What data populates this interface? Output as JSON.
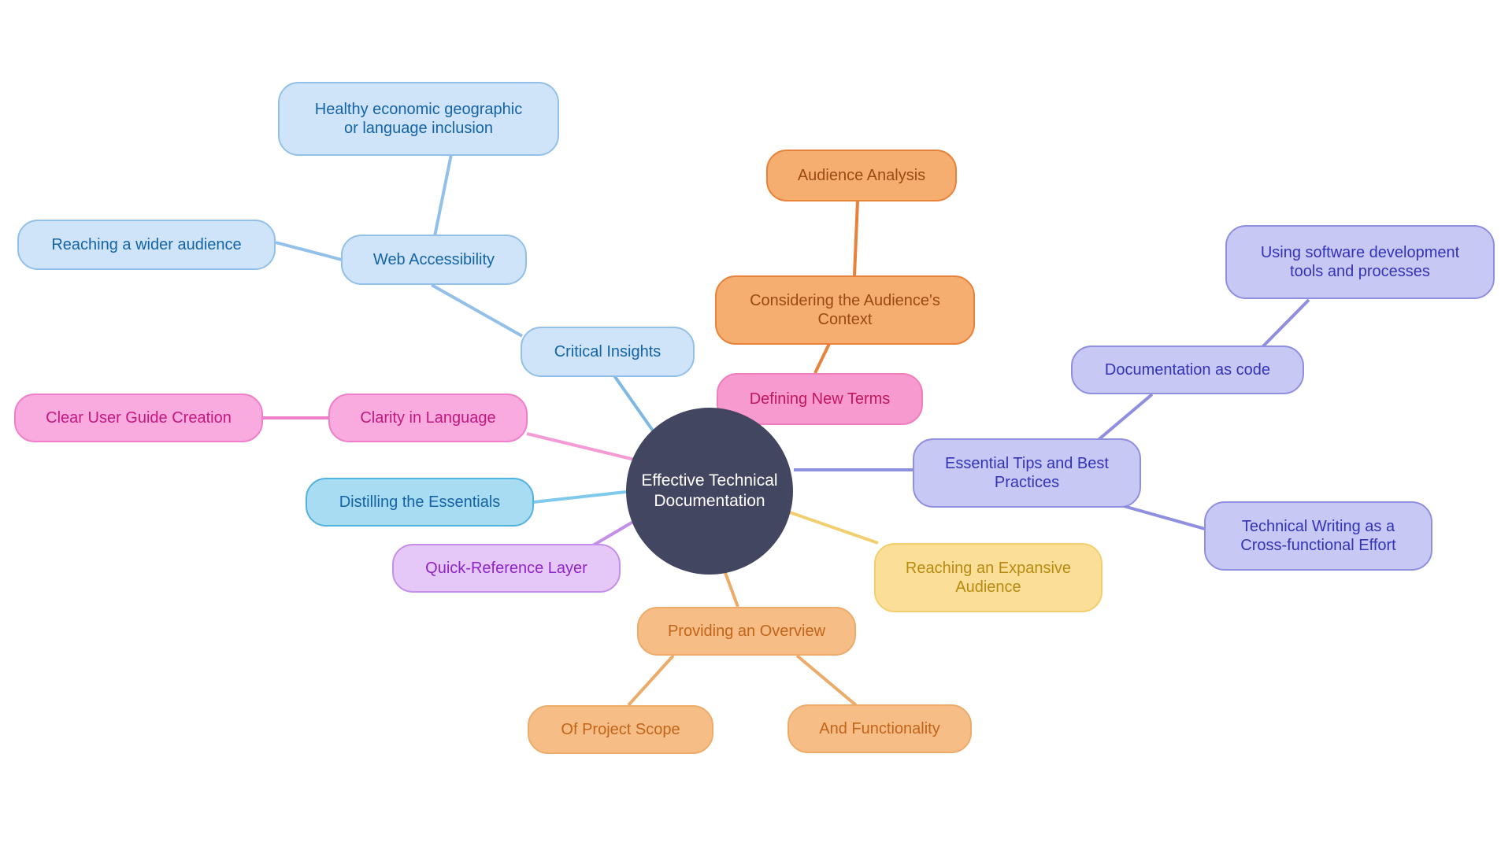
{
  "diagram": {
    "title": "Effective Technical Documentation",
    "type": "mindmap",
    "background": "#ffffff"
  },
  "nodes": {
    "root": {
      "label": "Effective Technical\nDocumentation"
    },
    "audience_analysis": {
      "label": "Audience Analysis"
    },
    "considering_context": {
      "label": "Considering the Audience's\nContext"
    },
    "defining_new_terms": {
      "label": "Defining New Terms"
    },
    "healthy_inclusion": {
      "label": "Healthy economic geographic\nor language inclusion"
    },
    "reaching_wider_audience": {
      "label": "Reaching a wider audience"
    },
    "web_accessibility": {
      "label": "Web Accessibility"
    },
    "critical_insights": {
      "label": "Critical Insights"
    },
    "clear_user_guide": {
      "label": "Clear User Guide Creation"
    },
    "clarity_in_language": {
      "label": "Clarity in Language"
    },
    "distilling_essentials": {
      "label": "Distilling the Essentials"
    },
    "quick_reference_layer": {
      "label": "Quick-Reference Layer"
    },
    "providing_overview": {
      "label": "Providing an Overview"
    },
    "of_project_scope": {
      "label": "Of Project Scope"
    },
    "and_functionality": {
      "label": "And Functionality"
    },
    "reaching_expansive_audience": {
      "label": "Reaching an Expansive\nAudience"
    },
    "essential_tips": {
      "label": "Essential Tips and Best\nPractices"
    },
    "documentation_as_code": {
      "label": "Documentation as code"
    },
    "using_software_tools": {
      "label": "Using software development\ntools and processes"
    },
    "technical_writing_cross": {
      "label": "Technical Writing as a\nCross-functional Effort"
    }
  },
  "colors": {
    "root_fill": "#434660",
    "root_text": "#ffffff",
    "blue_fill": "#cfe4f9",
    "blue_border": "#93c0e8",
    "blue_text": "#1464a5",
    "orange_fill": "#f6ad70",
    "orange_border": "#e8823a",
    "orange_text": "#9a4a12",
    "orange_light_fill": "#f7bd86",
    "orange_light_text": "#c2651a",
    "pink_fill": "#f9aade",
    "pink_border": "#ef7ecb",
    "pink_text": "#c2187f",
    "periwinkle_fill": "#c8c8f5",
    "periwinkle_border": "#8f8fe0",
    "periwinkle_text": "#3333b8",
    "violet_fill": "#e5c8f7",
    "violet_border": "#c48fe8",
    "violet_text": "#8e24c9",
    "cyan_fill": "#a8dcf2",
    "cyan_border": "#52b4dd",
    "yellow_fill": "#fbdf98",
    "yellow_border": "#f2ce6e",
    "yellow_text": "#b98a10"
  },
  "chart_data": {
    "type": "diagram",
    "title": "Effective Technical Documentation",
    "root": "Effective Technical Documentation",
    "branches": [
      {
        "name": "Critical Insights",
        "color": "#93c0e8",
        "children": [
          {
            "name": "Web Accessibility",
            "children": [
              {
                "name": "Reaching a wider audience"
              },
              {
                "name": "Healthy economic geographic or language inclusion"
              }
            ]
          }
        ]
      },
      {
        "name": "Considering the Audience's Context",
        "color": "#e8823a",
        "children": [
          {
            "name": "Audience Analysis"
          },
          {
            "name": "Defining New Terms"
          }
        ]
      },
      {
        "name": "Clarity in Language",
        "color": "#ef7ecb",
        "children": [
          {
            "name": "Clear User Guide Creation"
          }
        ]
      },
      {
        "name": "Distilling the Essentials",
        "color": "#52b4dd",
        "children": []
      },
      {
        "name": "Quick-Reference Layer",
        "color": "#c48fe8",
        "children": []
      },
      {
        "name": "Providing an Overview",
        "color": "#edab6a",
        "children": [
          {
            "name": "Of Project Scope"
          },
          {
            "name": "And Functionality"
          }
        ]
      },
      {
        "name": "Reaching an Expansive Audience",
        "color": "#f2ce6e",
        "children": []
      },
      {
        "name": "Essential Tips and Best Practices",
        "color": "#8f8fe0",
        "children": [
          {
            "name": "Documentation as code",
            "children": [
              {
                "name": "Using software development tools and processes"
              }
            ]
          },
          {
            "name": "Technical Writing as a Cross-functional Effort"
          }
        ]
      }
    ],
    "edges": [
      [
        "Effective Technical Documentation",
        "Critical Insights"
      ],
      [
        "Critical Insights",
        "Web Accessibility"
      ],
      [
        "Web Accessibility",
        "Reaching a wider audience"
      ],
      [
        "Web Accessibility",
        "Healthy economic geographic or language inclusion"
      ],
      [
        "Effective Technical Documentation",
        "Defining New Terms"
      ],
      [
        "Defining New Terms",
        "Considering the Audience's Context"
      ],
      [
        "Considering the Audience's Context",
        "Audience Analysis"
      ],
      [
        "Effective Technical Documentation",
        "Clarity in Language"
      ],
      [
        "Clarity in Language",
        "Clear User Guide Creation"
      ],
      [
        "Effective Technical Documentation",
        "Distilling the Essentials"
      ],
      [
        "Effective Technical Documentation",
        "Quick-Reference Layer"
      ],
      [
        "Effective Technical Documentation",
        "Providing an Overview"
      ],
      [
        "Providing an Overview",
        "Of Project Scope"
      ],
      [
        "Providing an Overview",
        "And Functionality"
      ],
      [
        "Effective Technical Documentation",
        "Reaching an Expansive Audience"
      ],
      [
        "Effective Technical Documentation",
        "Essential Tips and Best Practices"
      ],
      [
        "Essential Tips and Best Practices",
        "Documentation as code"
      ],
      [
        "Documentation as code",
        "Using software development tools and processes"
      ],
      [
        "Essential Tips and Best Practices",
        "Technical Writing as a Cross-functional Effort"
      ]
    ]
  }
}
